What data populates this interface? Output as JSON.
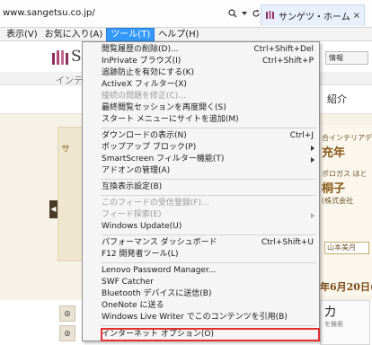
{
  "address_bar": {
    "url": "www.sangetsu.co.jp/",
    "search_glyph": "⌕",
    "dropdown_glyph": "▾",
    "refresh_glyph": "↻"
  },
  "tab": {
    "label": "サンゲツ・ホームページ...",
    "close_glyph": "×"
  },
  "menubar": {
    "items": [
      "表示(V)",
      "お気に入り(A)",
      "ツール(T)",
      "ヘルプ(H)"
    ],
    "active_index": 2
  },
  "page": {
    "brand": "SA",
    "info_button": "情報",
    "nav_text": "インテ",
    "section_title": "紹介",
    "hero_left_text": "サ",
    "arrow_glyph": "◀",
    "hero_right": {
      "line1": "合インテリアデザ",
      "year": "充年",
      "line3": "ポロガス ほと",
      "name": "桐子",
      "tag": "(株式会社",
      "box": "山本美月",
      "date": "年6月20日("
    },
    "footer": {
      "button1": "◎",
      "button2": "◎",
      "card_big": "カ",
      "card_small": "を検索"
    }
  },
  "tools_menu": {
    "items": [
      {
        "label": "閲覧履歴の削除(D)...",
        "shortcut": "Ctrl+Shift+Del",
        "disabled": false,
        "submenu": false
      },
      {
        "label": "InPrivate ブラウズ(I)",
        "shortcut": "Ctrl+Shift+P",
        "disabled": false,
        "submenu": false
      },
      {
        "label": "追跡防止を有効にする(K)",
        "shortcut": "",
        "disabled": false,
        "submenu": false
      },
      {
        "label": "ActiveX フィルター(X)",
        "shortcut": "",
        "disabled": false,
        "submenu": false
      },
      {
        "label": "接続の問題を修正(C)...",
        "shortcut": "",
        "disabled": true,
        "submenu": false
      },
      {
        "label": "最終閲覧セッションを再度開く(S)",
        "shortcut": "",
        "disabled": false,
        "submenu": false
      },
      {
        "label": "スタート メニューにサイトを追加(M)",
        "shortcut": "",
        "disabled": false,
        "submenu": false
      },
      {
        "label": "ダウンロードの表示(N)",
        "shortcut": "Ctrl+J",
        "disabled": false,
        "submenu": false
      },
      {
        "label": "ポップアップ ブロック(P)",
        "shortcut": "",
        "disabled": false,
        "submenu": true
      },
      {
        "label": "SmartScreen フィルター機能(T)",
        "shortcut": "",
        "disabled": false,
        "submenu": true
      },
      {
        "label": "アドオンの管理(A)",
        "shortcut": "",
        "disabled": false,
        "submenu": false
      },
      {
        "label": "互換表示設定(B)",
        "shortcut": "",
        "disabled": false,
        "submenu": false
      },
      {
        "label": "このフィードの受信登録(F)...",
        "shortcut": "",
        "disabled": true,
        "submenu": false
      },
      {
        "label": "フィード探索(E)",
        "shortcut": "",
        "disabled": true,
        "submenu": true
      },
      {
        "label": "Windows Update(U)",
        "shortcut": "",
        "disabled": false,
        "submenu": false
      },
      {
        "label": "パフォーマンス ダッシュボード",
        "shortcut": "Ctrl+Shift+U",
        "disabled": false,
        "submenu": false
      },
      {
        "label": "F12 開発者ツール(L)",
        "shortcut": "",
        "disabled": false,
        "submenu": false
      },
      {
        "label": "Lenovo Password Manager...",
        "shortcut": "",
        "disabled": false,
        "submenu": false
      },
      {
        "label": "SWF Catcher",
        "shortcut": "",
        "disabled": false,
        "submenu": false
      },
      {
        "label": "Bluetooth デバイスに送信(B)",
        "shortcut": "",
        "disabled": false,
        "submenu": false
      },
      {
        "label": "OneNote に送る",
        "shortcut": "",
        "disabled": false,
        "submenu": false
      },
      {
        "label": "Windows Live Writer でこのコンテンツを引用(B)",
        "shortcut": "",
        "disabled": false,
        "submenu": false
      },
      {
        "label": "インターネット オプション(O)",
        "shortcut": "",
        "disabled": false,
        "submenu": false,
        "highlighted": true
      }
    ]
  },
  "colors": {
    "menu_active": "#3399ff",
    "highlight_border": "#e53030",
    "disabled_text": "#9a9a9a"
  }
}
